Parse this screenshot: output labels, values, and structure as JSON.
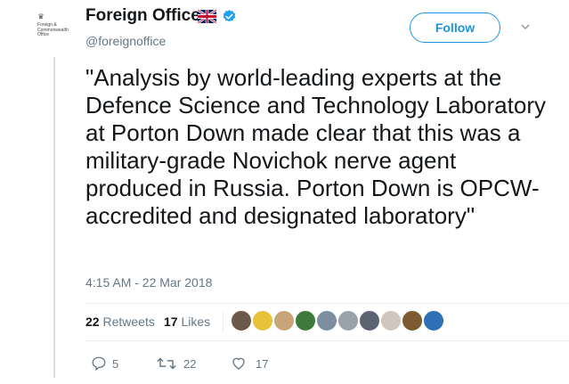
{
  "account": {
    "name": "Foreign Office",
    "handle": "@foreignoffice",
    "logo_text": "Foreign & Commonwealth Office",
    "flag_icon": "uk-flag-icon",
    "verified_icon": "verified-badge-icon"
  },
  "header": {
    "follow_label": "Follow",
    "menu_icon": "chevron-down-icon"
  },
  "tweet": {
    "text": "\"Analysis by world-leading experts at the Defence Science and Technology Laboratory at Porton Down made clear that this was a military-grade Novichok nerve agent produced in Russia. Porton Down is OPCW-accredited and designated laboratory\"",
    "timestamp": "4:15 AM - 22 Mar 2018"
  },
  "stats": {
    "retweets_count": "22",
    "retweets_label": "Retweets",
    "likes_count": "17",
    "likes_label": "Likes"
  },
  "likers": [
    {
      "name": "liker-avatar-1",
      "color": "#6b5a4a"
    },
    {
      "name": "liker-avatar-2",
      "color": "#e8c33a"
    },
    {
      "name": "liker-avatar-3",
      "color": "#c9a679"
    },
    {
      "name": "liker-avatar-4",
      "color": "#3e7a3c"
    },
    {
      "name": "liker-avatar-5",
      "color": "#7d8ea0"
    },
    {
      "name": "liker-avatar-6",
      "color": "#9aa3ab"
    },
    {
      "name": "liker-avatar-7",
      "color": "#5b6470"
    },
    {
      "name": "liker-avatar-8",
      "color": "#cfc7bd"
    },
    {
      "name": "liker-avatar-9",
      "color": "#7a5a2e"
    },
    {
      "name": "liker-avatar-10",
      "color": "#2f6fb3"
    }
  ],
  "actions": {
    "reply_count": "5",
    "retweet_count": "22",
    "like_count": "17"
  },
  "colors": {
    "accent": "#1b95e0",
    "text": "#14171a",
    "muted": "#657786"
  }
}
